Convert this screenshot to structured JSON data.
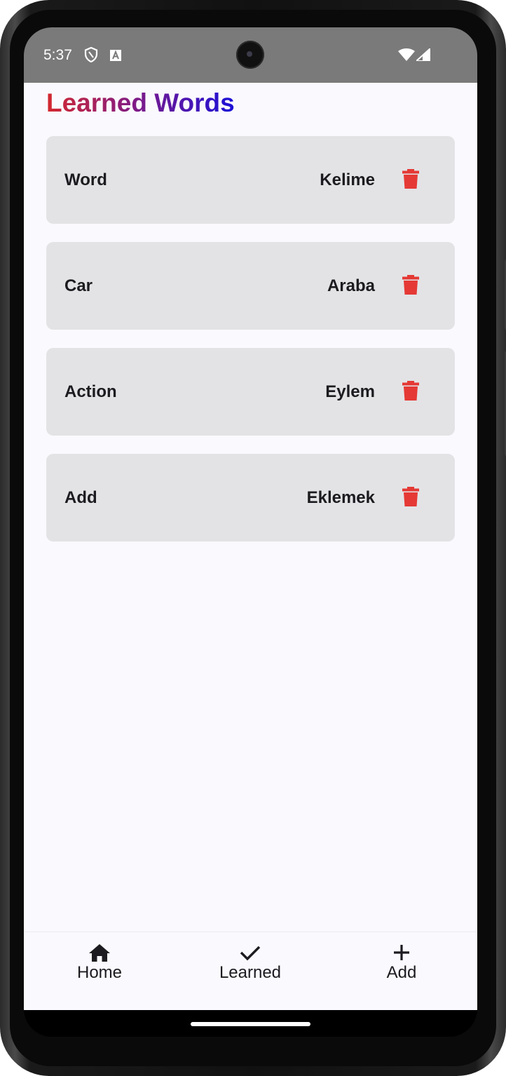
{
  "status_bar": {
    "time": "5:37",
    "icons": [
      "shield-icon",
      "a-notification-icon",
      "wifi-icon",
      "signal-icon"
    ]
  },
  "page": {
    "title": "Learned Words",
    "title_gradient": [
      "#d4282e",
      "#7a1a8c",
      "#1a10d8"
    ]
  },
  "words": [
    {
      "english": "Word",
      "turkish": "Kelime"
    },
    {
      "english": "Car",
      "turkish": "Araba"
    },
    {
      "english": "Action",
      "turkish": "Eylem"
    },
    {
      "english": "Add",
      "turkish": "Eklemek"
    }
  ],
  "colors": {
    "card_background": "#e3e3e5",
    "delete_icon": "#e53935",
    "screen_background": "#faf9fe",
    "status_bar": "#7a7a7a"
  },
  "bottom_nav": {
    "items": [
      {
        "label": "Home",
        "icon": "home-icon"
      },
      {
        "label": "Learned",
        "icon": "check-icon"
      },
      {
        "label": "Add",
        "icon": "plus-icon"
      }
    ]
  }
}
